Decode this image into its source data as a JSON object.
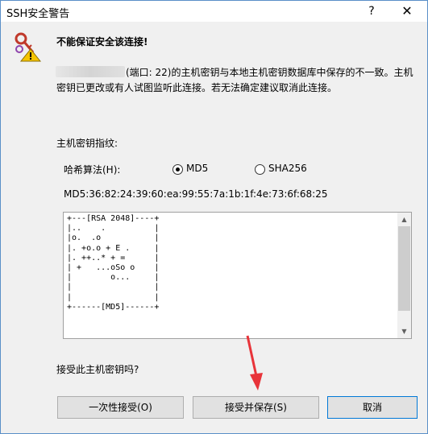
{
  "window": {
    "title": "SSH安全警告",
    "help_label": "?",
    "close_label": "✕"
  },
  "warning": {
    "icon": "keys-warning-icon",
    "heading": "不能保证安全该连接!",
    "message": "(端口: 22)的主机密钥与本地主机密钥数据库中保存的不一致。主机密钥已更改或有人试图监听此连接。若无法确定建议取消此连接。"
  },
  "fingerprint": {
    "label": "主机密钥指纹:",
    "hash_label": "哈希算法(H):",
    "options": [
      {
        "label": "MD5",
        "checked": true
      },
      {
        "label": "SHA256",
        "checked": false
      }
    ],
    "value": "MD5:36:82:24:39:60:ea:99:55:7a:1b:1f:4e:73:6f:68:25",
    "randomart": "+---[RSA 2048]----+\n|..    .          |\n|o.  .o           |\n|. +o.o + E .     |\n|. ++..* + =      |\n| +   ...oSo o    |\n|        o...     |\n|                 |\n|                 |\n+------[MD5]------+"
  },
  "prompt": {
    "question": "接受此主机密钥吗?"
  },
  "buttons": {
    "accept_once": "一次性接受(O)",
    "accept_save": "接受并保存(S)",
    "cancel": "取消"
  },
  "colors": {
    "annotation_arrow": "#e8343a",
    "window_border": "#5a8fc8",
    "default_button_border": "#0078d7"
  }
}
